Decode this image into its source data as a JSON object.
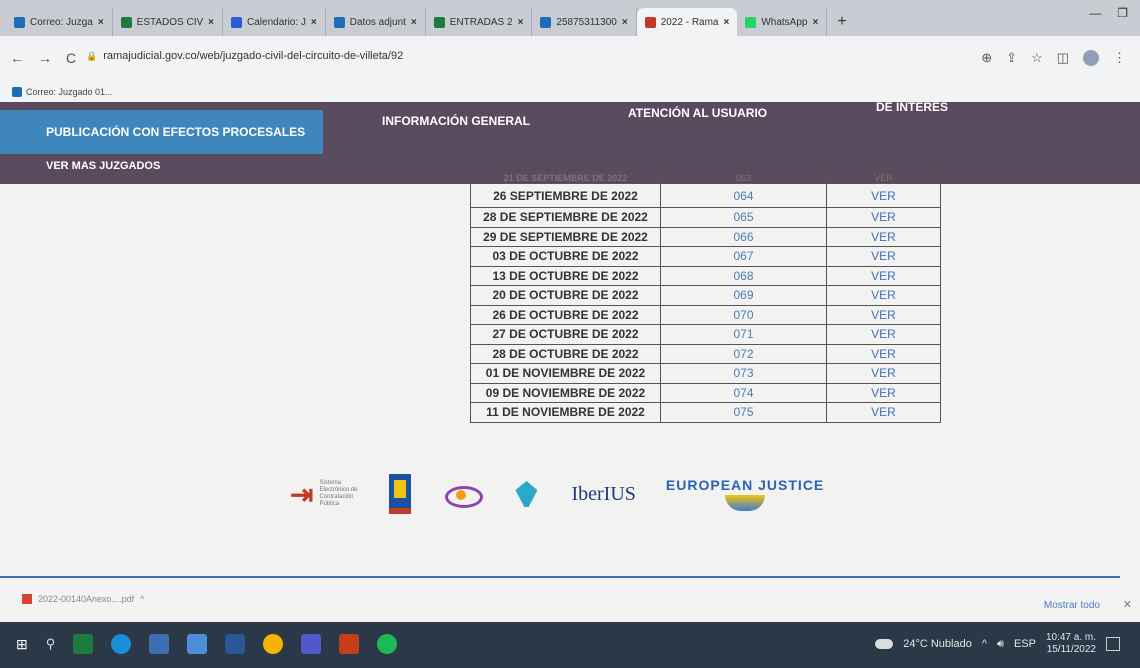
{
  "browser": {
    "tabs": [
      {
        "title": "Correo: Juzga",
        "color": "#1e6bb8",
        "active": false
      },
      {
        "title": "ESTADOS CIV",
        "color": "#1f7a40",
        "active": false
      },
      {
        "title": "Calendario: J",
        "color": "#2a5bd7",
        "active": false
      },
      {
        "title": "Datos adjunt",
        "color": "#1e6bb8",
        "active": false
      },
      {
        "title": "ENTRADAS 2",
        "color": "#1f7a40",
        "active": false
      },
      {
        "title": "25875311300",
        "color": "#1e6bb8",
        "active": false
      },
      {
        "title": "2022 - Rama",
        "color": "#c0392b",
        "active": true
      },
      {
        "title": "WhatsApp",
        "color": "#25d366",
        "active": false
      }
    ],
    "new_tab": "+",
    "url": "ramajudicial.gov.co/web/juzgado-civil-del-circuito-de-villeta/92",
    "bookmark": "Correo: Juzgado 01..."
  },
  "site_nav": {
    "items": [
      "PUBLICACIÓN CON EFECTOS PROCESALES",
      "INFORMACIÓN GENERAL",
      "ATENCIÓN AL USUARIO",
      "DE INTERÉS"
    ],
    "sub": "VER MAS JUZGADOS"
  },
  "table": {
    "partial_row": {
      "fecha": "21 DE SEPTIEMBRE DE 2022",
      "num": "063",
      "ver": "VER"
    },
    "rows": [
      {
        "fecha": "26 SEPTIEMBRE DE 2022",
        "num": "064",
        "ver": "VER"
      },
      {
        "fecha": "28 DE SEPTIEMBRE DE 2022",
        "num": "065",
        "ver": "VER"
      },
      {
        "fecha": "29 DE SEPTIEMBRE DE 2022",
        "num": "066",
        "ver": "VER"
      },
      {
        "fecha": "03 DE OCTUBRE DE 2022",
        "num": "067",
        "ver": "VER"
      },
      {
        "fecha": "13 DE OCTUBRE DE 2022",
        "num": "068",
        "ver": "VER"
      },
      {
        "fecha": "20 DE OCTUBRE DE 2022",
        "num": "069",
        "ver": "VER"
      },
      {
        "fecha": "26 DE OCTUBRE DE 2022",
        "num": "070",
        "ver": "VER"
      },
      {
        "fecha": "27 DE OCTUBRE DE 2022",
        "num": "071",
        "ver": "VER"
      },
      {
        "fecha": "28 DE OCTUBRE DE 2022",
        "num": "072",
        "ver": "VER"
      },
      {
        "fecha": "01 DE NOVIEMBRE DE 2022",
        "num": "073",
        "ver": "VER"
      },
      {
        "fecha": "09 DE NOVIEMBRE DE 2022",
        "num": "074",
        "ver": "VER"
      },
      {
        "fecha": "11 DE NOVIEMBRE DE 2022",
        "num": "075",
        "ver": "VER"
      }
    ]
  },
  "logos": {
    "secop": "Sistema Electrónico de Contratación Pública",
    "fiscalia": "FISCALIA",
    "iberius": "IberIUS",
    "ejustice": "EUROPEAN JUSTICE"
  },
  "download": {
    "file": "2022-00140Anexo....pdf",
    "show_all": "Mostrar todo"
  },
  "taskbar": {
    "weather": "24°C Nublado",
    "lang": "ESP",
    "time": "10:47 a. m.",
    "date": "15/11/2022"
  }
}
